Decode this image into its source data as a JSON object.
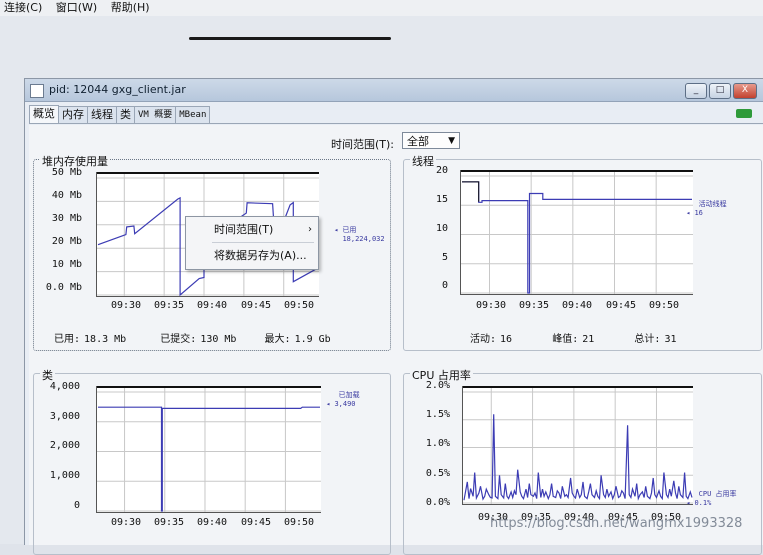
{
  "menubar": {
    "items": [
      "连接(C)",
      "窗口(W)",
      "帮助(H)"
    ]
  },
  "window": {
    "title": "pid: 12044 gxg_client.jar",
    "controls": {
      "minimize": "_",
      "restore": "□",
      "close": "X"
    }
  },
  "tabs": [
    {
      "label": "概览"
    },
    {
      "label": "内存"
    },
    {
      "label": "线程"
    },
    {
      "label": "类"
    },
    {
      "label": "VM 概要"
    },
    {
      "label": "MBean"
    }
  ],
  "time_range": {
    "label": "时间范围(T):",
    "value": "全部"
  },
  "context_menu": {
    "item1": "时间范围(T)",
    "item1_arrow": "›",
    "item2": "将数据另存为(A)..."
  },
  "watermark": "https://blog.csdn.net/wangmx1993328",
  "chart_data": [
    {
      "type": "line",
      "title": "堆内存使用量",
      "y_ticks": [
        "50 Mb",
        "40 Mb",
        "30 Mb",
        "20 Mb",
        "10 Mb",
        "0.0 Mb"
      ],
      "x_ticks": [
        "09:30",
        "09:35",
        "09:40",
        "09:45",
        "09:50"
      ],
      "ylim": [
        0,
        50
      ],
      "legend": {
        "name": "已用",
        "value": "18,224,032"
      },
      "stats": [
        {
          "label": "已用:",
          "value": "18.3 Mb"
        },
        {
          "label": "已提交:",
          "value": "130 Mb"
        },
        {
          "label": "最大:",
          "value": "1.9 Gb"
        }
      ],
      "color": "#3c3cb4",
      "series": [
        {
          "x": [
            0,
            3.5,
            3.6,
            4.5,
            4.6,
            10,
            10.3,
            10.3,
            12.7,
            13.3,
            13.3,
            14.3,
            14.4,
            18.6,
            18.7,
            21.9,
            22.0,
            22.1,
            24.1,
            24.5,
            24.5,
            27.3
          ],
          "values": [
            21.5,
            25.8,
            29.1,
            29.5,
            26.2,
            41.0,
            41.5,
            0.0,
            7.0,
            7.5,
            25.5,
            27.5,
            25.3,
            35.0,
            39.4,
            39.0,
            33.7,
            21.0,
            38.5,
            39.5,
            5.7,
            11.0
          ]
        }
      ]
    },
    {
      "type": "line",
      "title": "线程",
      "y_ticks": [
        "20",
        "15",
        "10",
        "5",
        "0"
      ],
      "x_ticks": [
        "09:30",
        "09:35",
        "09:40",
        "09:45",
        "09:50"
      ],
      "ylim": [
        0,
        20
      ],
      "legend": {
        "name": "活动线程",
        "value": "16"
      },
      "stats": [
        {
          "label": "活动:",
          "value": "16"
        },
        {
          "label": "峰值:",
          "value": "21"
        },
        {
          "label": "总计:",
          "value": "31"
        }
      ],
      "color": "#3c3cb4",
      "peak_color": "#111111",
      "series": [
        {
          "x": [
            0,
            2.0,
            2.0,
            2.4,
            2.4,
            7.9,
            7.9,
            8.1,
            8.1,
            9.7,
            9.7,
            27.6
          ],
          "values": [
            19,
            19,
            15.5,
            15.5,
            15.8,
            15.8,
            0,
            0,
            17,
            17,
            16,
            16
          ]
        }
      ]
    },
    {
      "type": "line",
      "title": "类",
      "y_ticks": [
        "4,000",
        "3,000",
        "2,000",
        "1,000",
        "0"
      ],
      "x_ticks": [
        "09:30",
        "09:35",
        "09:40",
        "09:45",
        "09:50"
      ],
      "ylim": [
        0,
        4000
      ],
      "legend": {
        "name": "已加载",
        "value": "3,490"
      },
      "color": "#3c3cb4",
      "series": [
        {
          "x": [
            0,
            7.9,
            7.9,
            8.0,
            8.0,
            25.2,
            25.4,
            27.6
          ],
          "values": [
            3490,
            3490,
            0,
            0,
            3450,
            3450,
            3490,
            3490
          ]
        }
      ]
    },
    {
      "type": "line",
      "title": "CPU 占用率",
      "y_ticks": [
        "2.0%",
        "1.5%",
        "1.0%",
        "0.5%",
        "0.0%"
      ],
      "x_ticks": [
        "09:30",
        "09:35",
        "09:40",
        "09:45",
        "09:50"
      ],
      "ylim": [
        0,
        2.0
      ],
      "legend": {
        "name": "CPU 占用率",
        "value": "0.1%"
      },
      "color": "#3c3cb4",
      "series": [
        {
          "x": [
            0,
            0.4,
            0.6,
            0.8,
            1.1,
            1.3,
            1.5,
            1.8,
            2.0,
            2.3,
            2.5,
            2.7,
            3.0,
            3.2,
            3.4,
            3.6,
            3.8,
            4.1,
            4.3,
            4.5,
            4.8,
            5.0,
            5.2,
            5.4,
            5.7,
            5.9,
            6.1,
            6.3,
            6.5,
            6.8,
            7.0,
            7.2,
            7.5,
            7.7,
            7.9,
            8.1,
            8.4,
            8.6,
            8.8,
            9.0,
            9.3,
            9.5,
            9.7,
            9.9,
            10.2,
            10.4,
            10.6,
            10.8,
            11.1,
            11.3,
            11.5,
            11.7,
            11.9,
            12.2,
            12.4,
            12.6,
            12.9,
            13.1,
            13.3,
            13.5,
            13.7,
            14.0,
            14.2,
            14.4,
            14.6,
            14.9,
            15.1,
            15.3,
            15.5,
            15.8,
            16.0,
            16.2,
            16.4,
            16.6,
            16.9,
            17.1,
            17.3,
            17.5,
            17.8,
            18.0,
            18.2,
            18.4,
            18.7,
            18.9,
            19.1,
            19.3,
            19.5,
            19.8,
            20.0,
            20.2,
            20.4,
            20.7,
            20.9,
            21.1,
            21.3,
            21.6,
            21.8,
            22.0,
            22.2,
            22.5,
            22.7,
            22.9,
            23.1,
            23.3,
            23.6,
            23.8,
            24.0,
            24.2,
            24.5,
            24.7,
            24.9,
            25.1,
            25.4,
            25.6,
            25.8,
            26.0,
            26.2,
            26.5,
            26.7,
            26.9,
            27.1,
            27.4,
            27.6
          ],
          "values": [
            0.05,
            0.38,
            0.08,
            0.26,
            0.12,
            0.55,
            0.09,
            0.18,
            0.3,
            0.07,
            0.12,
            0.25,
            0.15,
            0.1,
            0.09,
            1.6,
            0.12,
            0.08,
            0.5,
            0.15,
            0.09,
            0.35,
            0.12,
            0.08,
            0.2,
            0.1,
            0.22,
            0.15,
            0.6,
            0.2,
            0.12,
            0.08,
            0.25,
            0.1,
            0.35,
            0.15,
            0.12,
            0.18,
            0.08,
            0.55,
            0.1,
            0.25,
            0.12,
            0.2,
            0.08,
            0.15,
            0.35,
            0.12,
            0.1,
            0.22,
            0.18,
            0.08,
            0.3,
            0.12,
            0.15,
            0.1,
            0.45,
            0.18,
            0.12,
            0.09,
            0.25,
            0.1,
            0.15,
            0.38,
            0.12,
            0.08,
            0.2,
            0.35,
            0.15,
            0.1,
            0.22,
            0.12,
            0.08,
            0.5,
            0.15,
            0.1,
            0.25,
            0.12,
            0.2,
            0.08,
            0.15,
            0.3,
            0.1,
            0.12,
            0.22,
            0.18,
            0.08,
            1.4,
            0.15,
            0.1,
            0.25,
            0.12,
            0.35,
            0.08,
            0.15,
            0.2,
            0.1,
            0.3,
            0.12,
            0.08,
            0.18,
            0.45,
            0.15,
            0.1,
            0.22,
            0.12,
            0.08,
            0.55,
            0.15,
            0.1,
            0.25,
            0.12,
            0.4,
            0.18,
            0.08,
            0.3,
            0.15,
            0.1,
            0.55,
            0.12,
            0.08,
            0.2,
            0.1
          ]
        }
      ]
    }
  ]
}
